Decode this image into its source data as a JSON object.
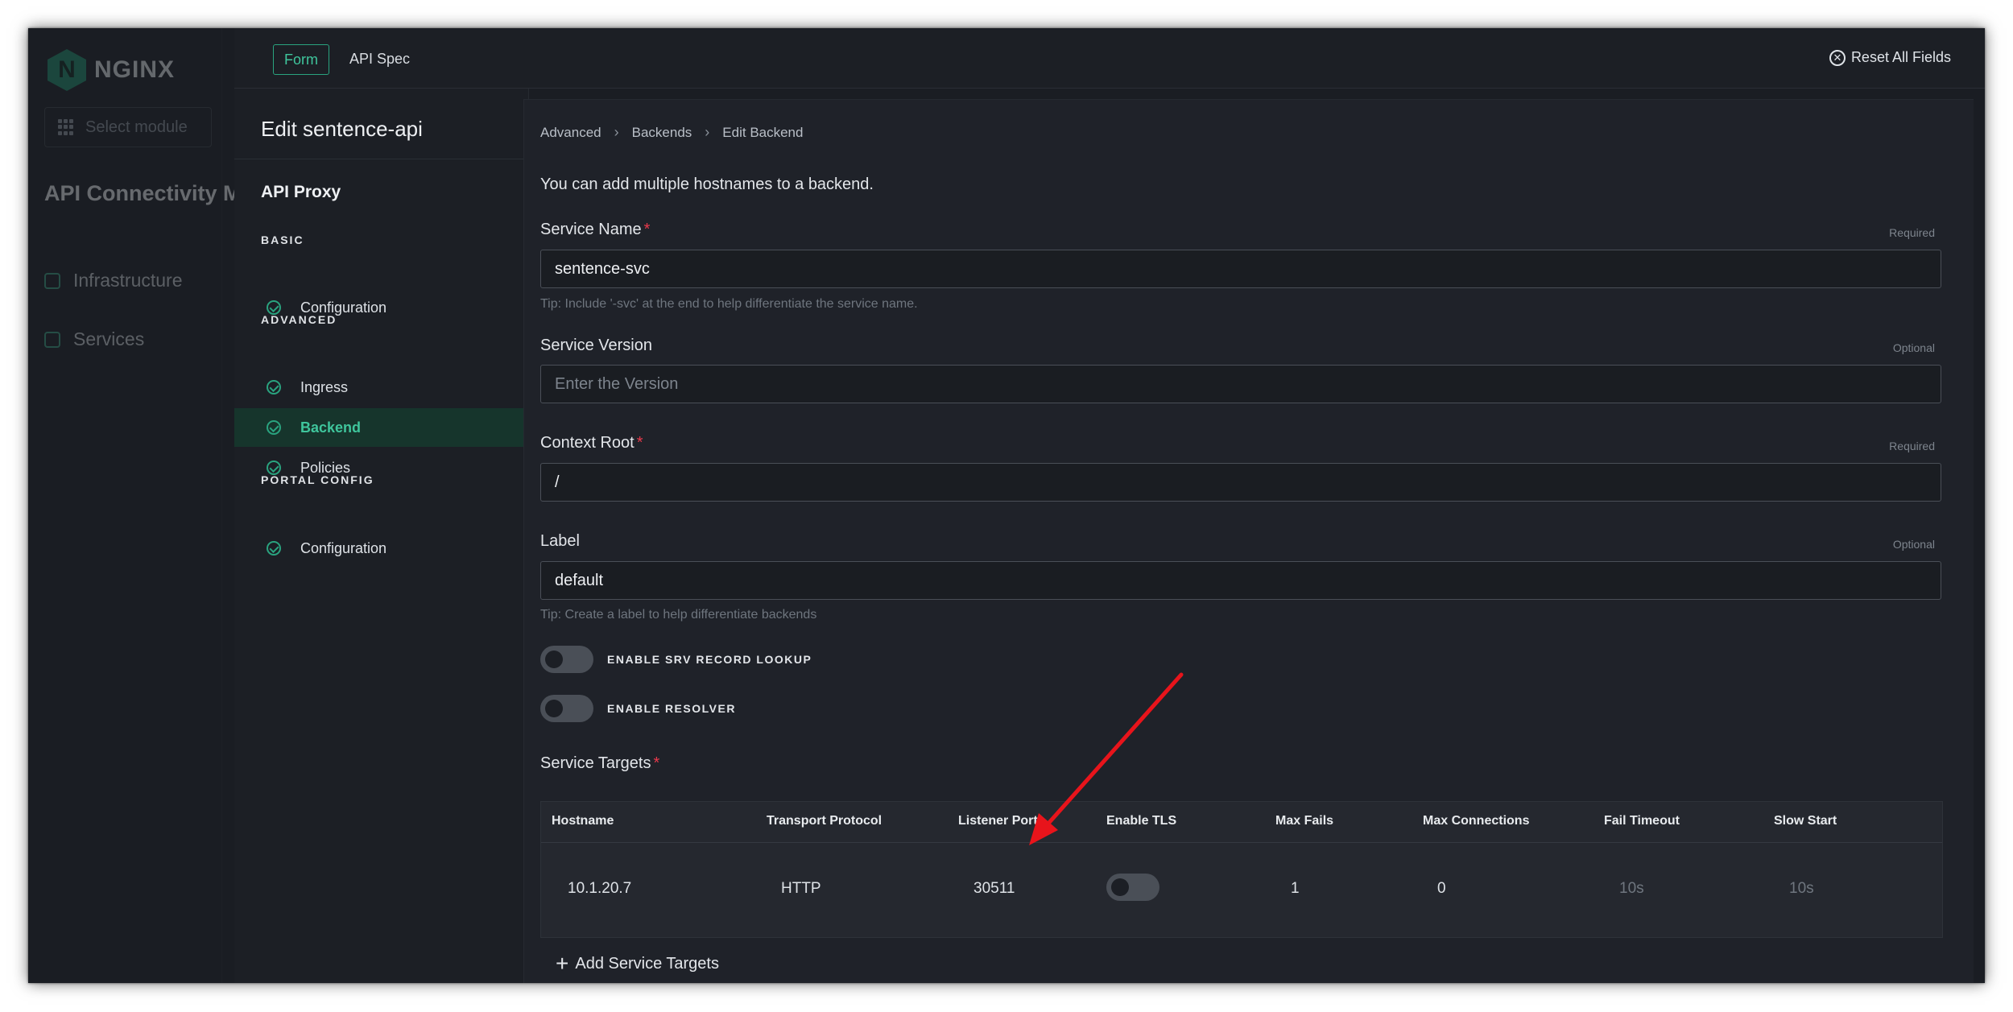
{
  "app": {
    "brand": "NGINX",
    "brand_sub": "NGINX",
    "module_placeholder": "Select module",
    "title": "API Connectivity Manager",
    "nav": [
      {
        "label": "Infrastructure",
        "icon": "infrastructure-icon"
      },
      {
        "label": "Services",
        "icon": "services-icon"
      }
    ]
  },
  "wizard": {
    "tabs": {
      "form": "Form",
      "api_spec": "API Spec"
    },
    "title": "Edit sentence-api",
    "section": "API Proxy",
    "groups": {
      "basic": "BASIC",
      "advanced": "ADVANCED",
      "portal": "PORTAL CONFIG"
    },
    "steps": {
      "basic_configuration": "Configuration",
      "ingress": "Ingress",
      "backend": "Backend",
      "policies": "Policies",
      "portal_configuration": "Configuration"
    },
    "active_step": "Backend"
  },
  "header": {
    "reset_label": "Reset All Fields"
  },
  "breadcrumb": [
    "Advanced",
    "Backends",
    "Edit Backend"
  ],
  "form": {
    "intro": "You can add multiple hostnames to a backend.",
    "service_name": {
      "label": "Service Name",
      "required_mark": "*",
      "hint": "Required",
      "value": "sentence-svc",
      "tip": "Tip: Include '-svc' at the end to help differentiate the service name."
    },
    "service_version": {
      "label": "Service Version",
      "hint": "Optional",
      "placeholder": "Enter the Version"
    },
    "context_root": {
      "label": "Context Root",
      "required_mark": "*",
      "hint": "Required",
      "value": "/"
    },
    "label": {
      "label": "Label",
      "hint": "Optional",
      "value": "default",
      "tip": "Tip: Create a label to help differentiate backends"
    },
    "toggles": {
      "srv_lookup": {
        "label": "ENABLE SRV RECORD LOOKUP",
        "on": false
      },
      "resolver": {
        "label": "ENABLE RESOLVER",
        "on": false
      }
    },
    "service_targets": {
      "label": "Service Targets",
      "required_mark": "*",
      "columns": [
        "Hostname",
        "Transport Protocol",
        "Listener Port",
        "Enable TLS",
        "Max Fails",
        "Max Connections",
        "Fail Timeout",
        "Slow Start"
      ],
      "rows": [
        {
          "hostname": "10.1.20.7",
          "protocol": "HTTP",
          "port": "30511",
          "tls": false,
          "max_fails": "1",
          "max_connections": "0",
          "fail_timeout": "10s",
          "slow_start": "10s"
        }
      ],
      "add_label": "Add Service Targets"
    }
  },
  "colors": {
    "accent": "#2aa37f",
    "required": "#e8394b",
    "annotation_arrow": "#e8141b"
  }
}
